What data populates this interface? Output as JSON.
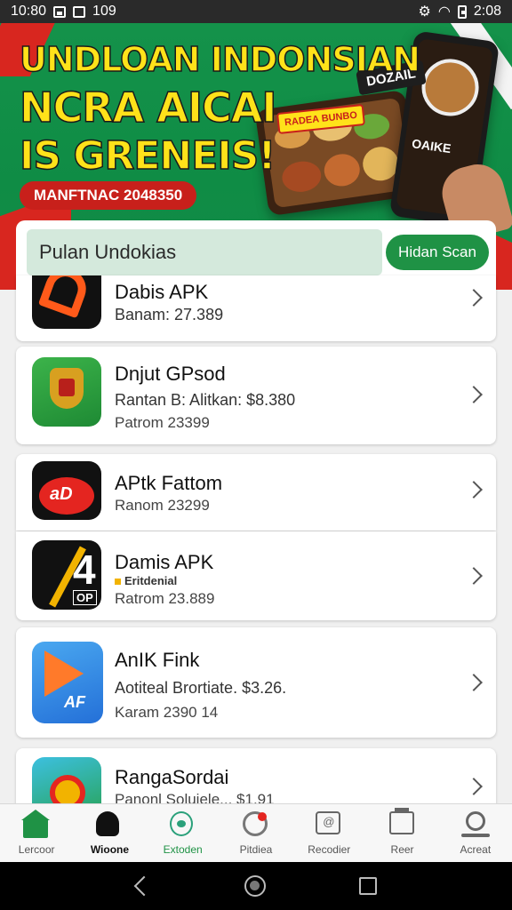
{
  "status_bar": {
    "time": "10:80",
    "left_extra": "109",
    "right_time": "2:08",
    "icons": [
      "image-icon",
      "gallery-icon",
      "alarm-icon",
      "wifi-icon",
      "battery-icon"
    ]
  },
  "banner": {
    "title_line1": "UNDLOAN INDONSIAN",
    "title_line2": "NCRA AICAI",
    "title_line3": "IS GRENEIS!",
    "pill_text": "MANFTNAC 2048350",
    "tag_text": "RADEA BUNBO",
    "logo_text": "DOZAIL",
    "phone_text": "OAIKE",
    "colors": {
      "green": "#14924a",
      "red": "#d8261f",
      "yellow": "#ffe21a"
    }
  },
  "search": {
    "value": "Pulan Undokias",
    "button_label": "Hidan Scan"
  },
  "apps": [
    {
      "name": "Dabis APK",
      "line1": "Banam: 27.389",
      "line2": "",
      "icon": "orange-swoosh-app-icon"
    },
    {
      "name": "Dnjut GPsod",
      "line1": "Rantan B: Alitkan: $8.380",
      "line2": "Patrom 23399",
      "icon": "garuda-emblem-app-icon"
    },
    {
      "name": "APtk Fattom",
      "line1": "Ranom 23299",
      "line2": "",
      "icon": "red-ad-app-icon"
    },
    {
      "name": "Damis APK",
      "badge": "Eritdenial",
      "line1": "Ratrom 23.889",
      "line2": "",
      "icon": "number-4-app-icon"
    },
    {
      "name": "AnIK Fink",
      "line1": "Aotiteal Brortiate. $3.26.",
      "line2": "Karam 2390 14",
      "icon": "play-arrow-app-icon"
    },
    {
      "name": "RangaSordai",
      "line1": "Panonl Soluiele... $1.91",
      "line2": "",
      "icon": "ring-app-icon"
    }
  ],
  "bottom_nav": [
    {
      "label": "Lercoor",
      "icon": "home-icon",
      "active": false
    },
    {
      "label": "Wioone",
      "icon": "person-icon",
      "active": false
    },
    {
      "label": "Extoden",
      "icon": "drop-icon",
      "active": true
    },
    {
      "label": "Pitdiea",
      "icon": "ring-icon",
      "active": false
    },
    {
      "label": "Recodier",
      "icon": "message-box-icon",
      "active": false
    },
    {
      "label": "Reer",
      "icon": "folder-icon",
      "active": false
    },
    {
      "label": "Acreat",
      "icon": "search-icon",
      "active": false
    }
  ],
  "system_nav": [
    "back-icon",
    "home-circle-icon",
    "recents-icon"
  ]
}
